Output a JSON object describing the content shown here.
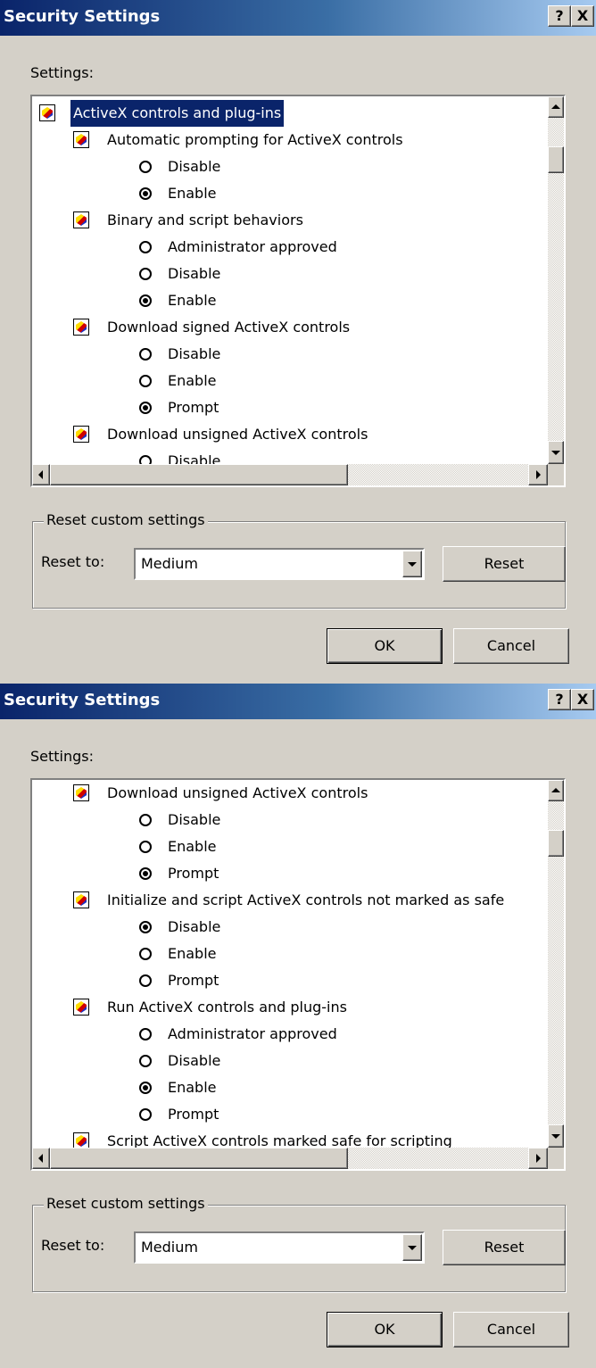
{
  "dialogs": [
    {
      "title": "Security Settings",
      "help_label": "?",
      "close_label": "X",
      "settings_label": "Settings:",
      "tree": [
        {
          "kind": "category",
          "level": 0,
          "label": "ActiveX controls and plug-ins",
          "selected": true
        },
        {
          "kind": "setting",
          "level": 1,
          "label": "Automatic prompting for ActiveX controls"
        },
        {
          "kind": "option",
          "label": "Disable",
          "checked": false
        },
        {
          "kind": "option",
          "label": "Enable",
          "checked": true
        },
        {
          "kind": "setting",
          "level": 1,
          "label": "Binary and script behaviors"
        },
        {
          "kind": "option",
          "label": "Administrator approved",
          "checked": false
        },
        {
          "kind": "option",
          "label": "Disable",
          "checked": false
        },
        {
          "kind": "option",
          "label": "Enable",
          "checked": true
        },
        {
          "kind": "setting",
          "level": 1,
          "label": "Download signed ActiveX controls"
        },
        {
          "kind": "option",
          "label": "Disable",
          "checked": false
        },
        {
          "kind": "option",
          "label": "Enable",
          "checked": false
        },
        {
          "kind": "option",
          "label": "Prompt",
          "checked": true
        },
        {
          "kind": "setting",
          "level": 1,
          "label": "Download unsigned ActiveX controls"
        },
        {
          "kind": "option",
          "label": "Disable",
          "checked": false
        }
      ],
      "group_label": "Reset custom settings",
      "reset_to_label": "Reset to:",
      "reset_to_value": "Medium",
      "reset_button": "Reset",
      "ok_button": "OK",
      "cancel_button": "Cancel"
    },
    {
      "title": "Security Settings",
      "help_label": "?",
      "close_label": "X",
      "settings_label": "Settings:",
      "tree": [
        {
          "kind": "setting",
          "level": 1,
          "label": "Download unsigned ActiveX controls"
        },
        {
          "kind": "option",
          "label": "Disable",
          "checked": false
        },
        {
          "kind": "option",
          "label": "Enable",
          "checked": false
        },
        {
          "kind": "option",
          "label": "Prompt",
          "checked": true
        },
        {
          "kind": "setting",
          "level": 1,
          "label": "Initialize and script ActiveX controls not marked as safe"
        },
        {
          "kind": "option",
          "label": "Disable",
          "checked": true
        },
        {
          "kind": "option",
          "label": "Enable",
          "checked": false
        },
        {
          "kind": "option",
          "label": "Prompt",
          "checked": false
        },
        {
          "kind": "setting",
          "level": 1,
          "label": "Run ActiveX controls and plug-ins"
        },
        {
          "kind": "option",
          "label": "Administrator approved",
          "checked": false
        },
        {
          "kind": "option",
          "label": "Disable",
          "checked": false
        },
        {
          "kind": "option",
          "label": "Enable",
          "checked": true
        },
        {
          "kind": "option",
          "label": "Prompt",
          "checked": false
        },
        {
          "kind": "setting",
          "level": 1,
          "label": "Script ActiveX controls marked safe for scripting"
        }
      ],
      "group_label": "Reset custom settings",
      "reset_to_label": "Reset to:",
      "reset_to_value": "Medium",
      "reset_button": "Reset",
      "ok_button": "OK",
      "cancel_button": "Cancel"
    }
  ]
}
